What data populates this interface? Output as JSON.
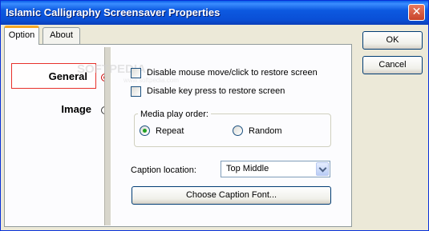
{
  "window": {
    "title": "Islamic Calligraphy Screensaver Properties",
    "close_glyph": "✕"
  },
  "tabs": [
    {
      "label": "Option",
      "active": true
    },
    {
      "label": "About",
      "active": false
    }
  ],
  "nav": {
    "general": "General",
    "image": "Image",
    "selected": "General"
  },
  "watermark": {
    "main": "SOFTPEDIA",
    "sub": "www.softpedia.com"
  },
  "options": {
    "disable_mouse": {
      "label": "Disable mouse move/click to restore screen",
      "checked": false
    },
    "disable_key": {
      "label": "Disable key press to restore screen",
      "checked": false
    }
  },
  "media_order": {
    "title": "Media play order:",
    "repeat": "Repeat",
    "random": "Random",
    "selected": "Repeat"
  },
  "caption": {
    "label": "Caption location:",
    "value": "Top Middle"
  },
  "buttons": {
    "font": "Choose Caption Font...",
    "ok": "OK",
    "cancel": "Cancel"
  },
  "colors": {
    "titlebar": "#0a4fd6",
    "selection_border": "#e8302a",
    "tab_accent": "#f5a623",
    "radio_selected": "#21a121"
  }
}
